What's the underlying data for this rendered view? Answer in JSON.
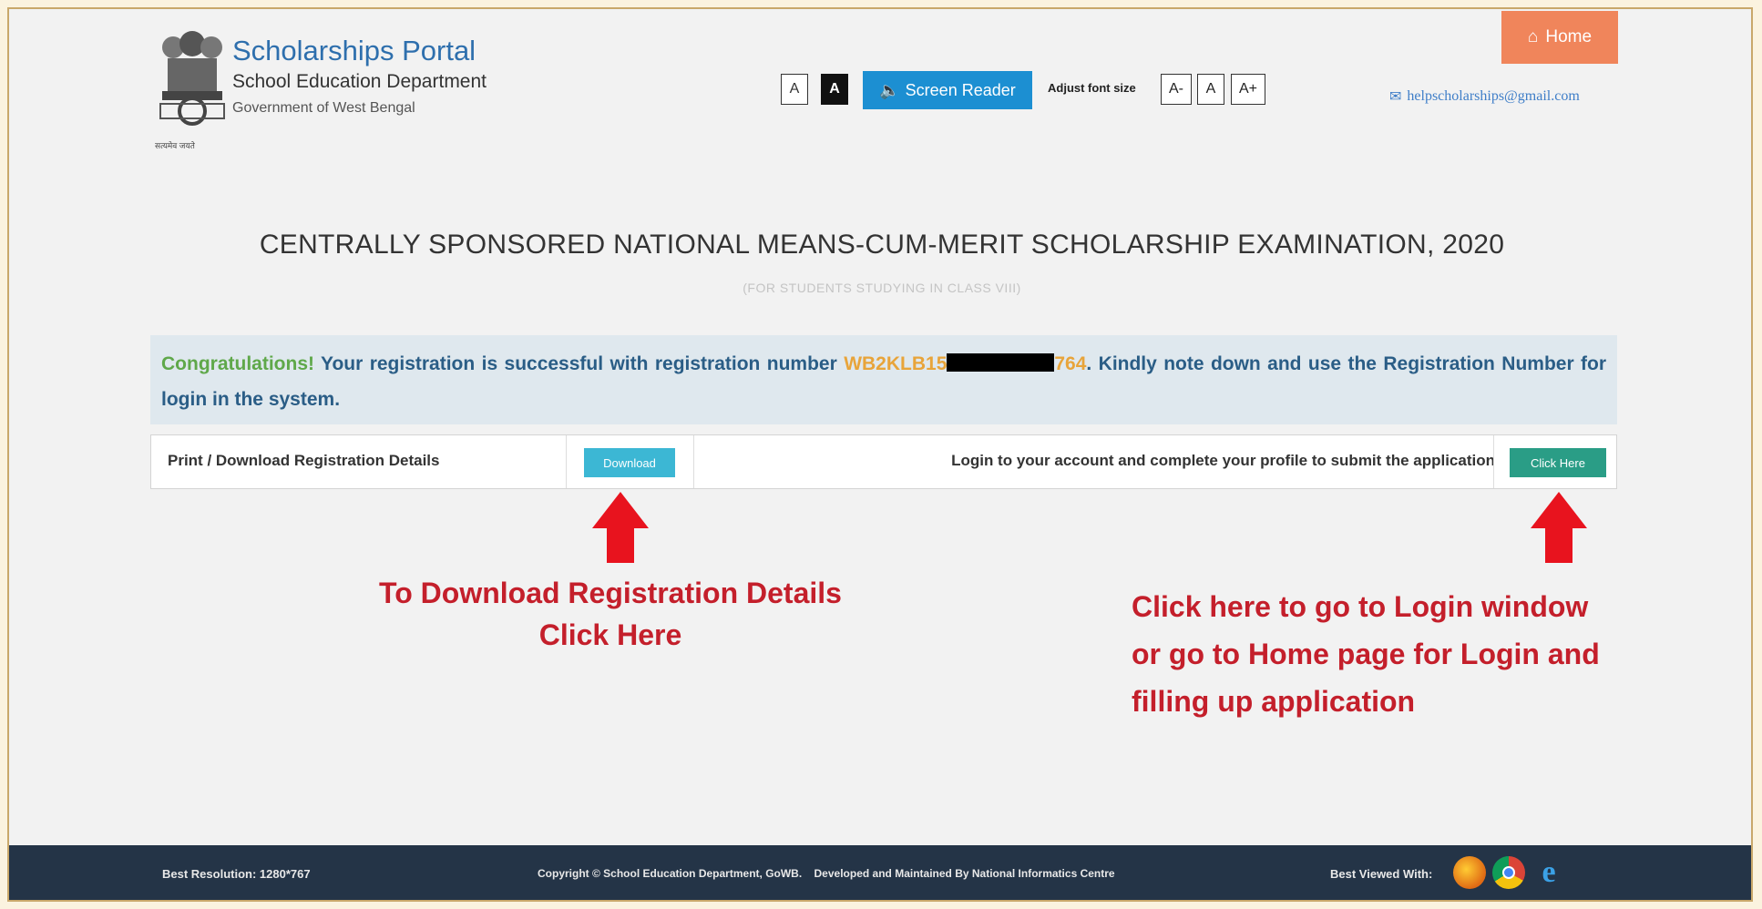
{
  "header": {
    "portal_title": "Scholarships Portal",
    "department": "School Education Department",
    "government": "Government of West Bengal",
    "emblem_caption": "सत्यमेव जयते",
    "text_small_btn": "A",
    "text_contrast_btn": "A",
    "screen_reader_label": "Screen Reader",
    "adjust_font_label": "Adjust font size",
    "font_decrease": "A-",
    "font_normal": "A",
    "font_increase": "A+",
    "home_label": "Home",
    "email": "helpscholarships@gmail.com"
  },
  "page": {
    "title": "CENTRALLY SPONSORED NATIONAL MEANS-CUM-MERIT SCHOLARSHIP EXAMINATION, 2020",
    "subtitle": "(FOR STUDENTS STUDYING IN CLASS VIII)"
  },
  "message": {
    "congrats": "Congratulations!",
    "text_before": " Your registration is successful with registration number ",
    "reg_prefix": "WB2KLB15",
    "reg_suffix": "764",
    "text_after": ". Kindly note down and use the Registration Number for login in the system."
  },
  "actions": {
    "print_label": "Print / Download Registration Details",
    "download_btn": "Download",
    "login_text": "Login to your account and complete your profile to submit the application",
    "click_here_btn": "Click Here"
  },
  "annotations": {
    "left_line1": "To Download Registration Details",
    "left_line2": "Click Here",
    "right_line1": "Click here to go to Login window",
    "right_line2": "or go to Home page for Login and",
    "right_line3": "filling up application",
    "arrow_color": "#e8131e"
  },
  "footer": {
    "resolution": "Best Resolution: 1280*767",
    "copyright": "Copyright © School Education Department, GoWB.    Developed and Maintained By National Informatics Centre",
    "best_viewed": "Best Viewed With:",
    "browsers": [
      "firefox-icon",
      "chrome-icon",
      "ie-icon"
    ]
  },
  "colors": {
    "brand_blue": "#2e6fad",
    "home_orange": "#f0855b",
    "screen_reader_blue": "#1c8fd2",
    "congrats_green": "#5fa84a",
    "reg_orange": "#e8a43a",
    "annotation_red": "#c41f2b",
    "footer_bg": "#243447"
  }
}
